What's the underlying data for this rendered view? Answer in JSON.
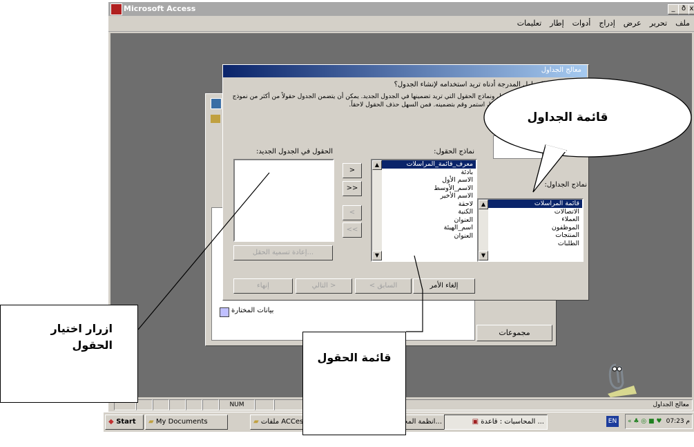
{
  "app": {
    "title": "Microsoft Access",
    "controls": {
      "minimize": "_",
      "restore": "ð",
      "close": "x"
    }
  },
  "menu": {
    "items": [
      "ملف",
      "تحرير",
      "عرض",
      "إدراج",
      "أدوات",
      "إطار",
      "تعليمات"
    ]
  },
  "dialog": {
    "title": "معالج الجداول",
    "question": "أي من نماذج الجداول المدرجة أدناه تريد استخدامه لإنشاء الجدول؟",
    "description": "بعد اختيار فئة، اختر نموذج الجدول ونماذج الحقول التي تريد تضمينها في الجدول الجديد. يمكن أن يتضمن الجدول حقولاً من أكثر من نموذج لجدول. إذا لم تكن متأكداً من حقل ما، استمر وقم بتضمينه. فمن السهل حذف الحقول لاحقاً.",
    "sample_tables_label": "نماذج الجداول:",
    "sample_tables": [
      "قائمة المراسلات",
      "الاتصالات",
      "العملاء",
      "الموظفون",
      "المنتجات",
      "الطلبات"
    ],
    "sample_fields_label": "نماذج الحقول:",
    "sample_fields": [
      "معرف_قائمة_المراسلات",
      "بادئة",
      "الاسم الأول",
      "الاسم_الأوسط",
      "الاسم الأخير",
      "لاحقة",
      "الكنية",
      "العنوان",
      "اسم_الهيئة",
      "العنوان"
    ],
    "new_fields_label": "الحقول في الجدول الجديد:",
    "move_buttons": [
      ">",
      ">>",
      "<",
      "<<"
    ],
    "rename_field": "إعادة تسمية الحقل...",
    "footer_buttons": {
      "cancel": "إلغاء الأمر",
      "back": "< السابق",
      "next": "التالي >",
      "finish": "إنهاء"
    }
  },
  "db_window": {
    "row_label": "بيانات المختارة",
    "groups": "مجموعات"
  },
  "status": {
    "text": "معالج الجداول",
    "num": "NUM"
  },
  "taskbar": {
    "start": "Start",
    "buttons": [
      "My Documents",
      "ملفات ACCess",
      "...انظمة المحاسبة وال",
      "... المحاسبات : قاعدة"
    ],
    "lang": "EN",
    "clock": "07:23 م"
  },
  "callouts": {
    "tables_list": "قائمة الجداول",
    "fields_list": "قائمة الحقول",
    "field_buttons": "ازرار اختيار الحقول"
  }
}
